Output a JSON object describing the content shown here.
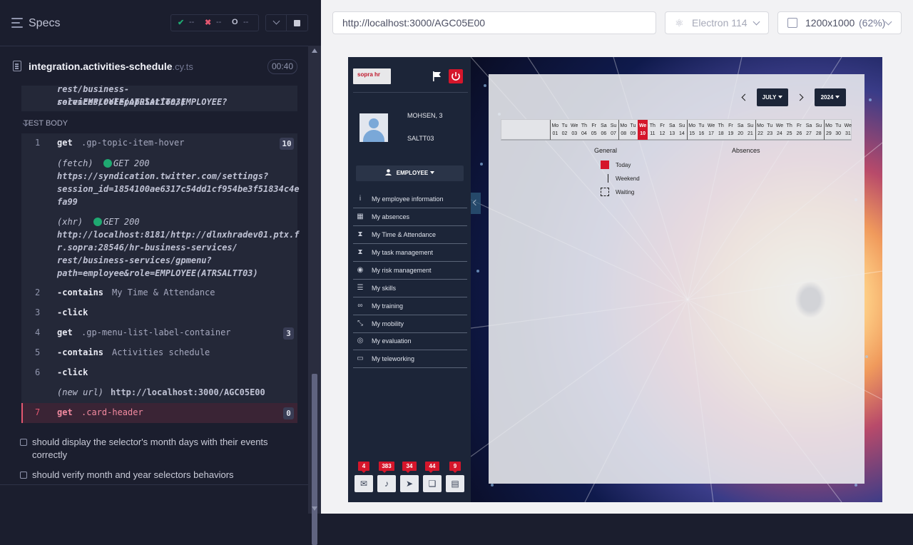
{
  "specs_bar": {
    "title": "Specs",
    "passed": "--",
    "failed": "--",
    "pending": "--"
  },
  "spec_file": {
    "name": "integration.activities-schedule",
    "ext": ".cy.ts",
    "duration": "00:40"
  },
  "log": {
    "prev_block": [
      "rest/business-services/rolepopulation/EMPLOYEE?",
      "role=EMPLOYEE(ATRSALTT03)"
    ],
    "section": "TEST BODY",
    "commands": [
      {
        "num": "1",
        "name": "get",
        "arg": ".gp-topic-item-hover",
        "count": "10"
      },
      {
        "num": "2",
        "name": "-contains",
        "arg": "My Time & Attendance"
      },
      {
        "num": "3",
        "name": "-click",
        "arg": ""
      },
      {
        "num": "4",
        "name": "get",
        "arg": ".gp-menu-list-label-container",
        "count": "3"
      },
      {
        "num": "5",
        "name": "-contains",
        "arg": "Activities schedule"
      },
      {
        "num": "6",
        "name": "-click",
        "arg": ""
      },
      {
        "num": "7",
        "name": "get",
        "arg": ".card-header",
        "count": "0"
      }
    ],
    "fetch": {
      "type": "(fetch)",
      "status": "GET 200",
      "url": [
        "https://syndication.twitter.com/settings?",
        "session_id=1854100ae6317c54dd1cf954be3f51834c4e",
        "fa99"
      ]
    },
    "xhr": {
      "type": "(xhr)",
      "status": "GET 200",
      "url": [
        "http://localhost:8181/http://dlnxhradev01.ptx.f",
        "r.sopra:28546/hr-business-services/",
        "rest/business-services/gpmenu?",
        "path=employee&role=EMPLOYEE(ATRSALTT03)"
      ]
    },
    "new_url": {
      "label": "(new url)",
      "value": "http://localhost:3000/AGC05E00"
    }
  },
  "tests": [
    {
      "title_line1": "should display the selector's month days with their events",
      "title_line2": "correctly"
    },
    {
      "title_line1": "should verify month and year selectors behaviors",
      "title_line2": ""
    }
  ],
  "preview": {
    "url": "http://localhost:3000/AGC05E00",
    "browser": "Electron 114",
    "viewport": "1200x1000",
    "zoom": "(62%)"
  },
  "app": {
    "logo_text": "sopra hr",
    "user_name": "MOHSEN, 3",
    "user_id": "SALTT03",
    "role": "EMPLOYEE",
    "menu": [
      {
        "label": "My employee information",
        "icon": "info-icon"
      },
      {
        "label": "My absences",
        "icon": "calendar-icon"
      },
      {
        "label": "My Time & Attendance",
        "icon": "hourglass-icon"
      },
      {
        "label": "My task management",
        "icon": "hourglass-icon"
      },
      {
        "label": "My risk management",
        "icon": "compass-icon"
      },
      {
        "label": "My skills",
        "icon": "list-icon"
      },
      {
        "label": "My training",
        "icon": "link-icon"
      },
      {
        "label": "My mobility",
        "icon": "arrows-icon"
      },
      {
        "label": "My evaluation",
        "icon": "target-icon"
      },
      {
        "label": "My teleworking",
        "icon": "laptop-icon"
      }
    ],
    "quick_badges": [
      {
        "count": "4",
        "icon": "mail-icon"
      },
      {
        "count": "383",
        "icon": "bell-icon"
      },
      {
        "count": "34",
        "icon": "send-icon"
      },
      {
        "count": "44",
        "icon": "bookmark-icon"
      },
      {
        "count": "9",
        "icon": "document-icon"
      }
    ],
    "month": "JULY",
    "year": "2024",
    "days": [
      {
        "dow": "Mo",
        "d": "01"
      },
      {
        "dow": "Tu",
        "d": "02"
      },
      {
        "dow": "We",
        "d": "03"
      },
      {
        "dow": "Th",
        "d": "04"
      },
      {
        "dow": "Fr",
        "d": "05"
      },
      {
        "dow": "Sa",
        "d": "06"
      },
      {
        "dow": "Su",
        "d": "07"
      },
      {
        "dow": "Mo",
        "d": "08"
      },
      {
        "dow": "Tu",
        "d": "09"
      },
      {
        "dow": "We",
        "d": "10"
      },
      {
        "dow": "Th",
        "d": "11"
      },
      {
        "dow": "Fr",
        "d": "12"
      },
      {
        "dow": "Sa",
        "d": "13"
      },
      {
        "dow": "Su",
        "d": "14"
      },
      {
        "dow": "Mo",
        "d": "15"
      },
      {
        "dow": "Tu",
        "d": "16"
      },
      {
        "dow": "We",
        "d": "17"
      },
      {
        "dow": "Th",
        "d": "18"
      },
      {
        "dow": "Fr",
        "d": "19"
      },
      {
        "dow": "Sa",
        "d": "20"
      },
      {
        "dow": "Su",
        "d": "21"
      },
      {
        "dow": "Mo",
        "d": "22"
      },
      {
        "dow": "Tu",
        "d": "23"
      },
      {
        "dow": "We",
        "d": "24"
      },
      {
        "dow": "Th",
        "d": "25"
      },
      {
        "dow": "Fr",
        "d": "26"
      },
      {
        "dow": "Sa",
        "d": "27"
      },
      {
        "dow": "Su",
        "d": "28"
      },
      {
        "dow": "Mo",
        "d": "29"
      },
      {
        "dow": "Tu",
        "d": "30"
      },
      {
        "dow": "We",
        "d": "31"
      }
    ],
    "today": "10",
    "legend": {
      "general": "General",
      "absences": "Absences",
      "items": [
        {
          "label": "Today",
          "color": "#d5162b"
        },
        {
          "label": "Weekend",
          "color": "#1a1a1a"
        },
        {
          "label": "Waiting",
          "color": "#1a1a1a"
        }
      ]
    }
  },
  "colors": {
    "accent": "#d5162b",
    "sidebar": "#1c2538",
    "log_bg": "#1b1e2e",
    "fail": "#e45770",
    "pass": "#1fa971"
  }
}
